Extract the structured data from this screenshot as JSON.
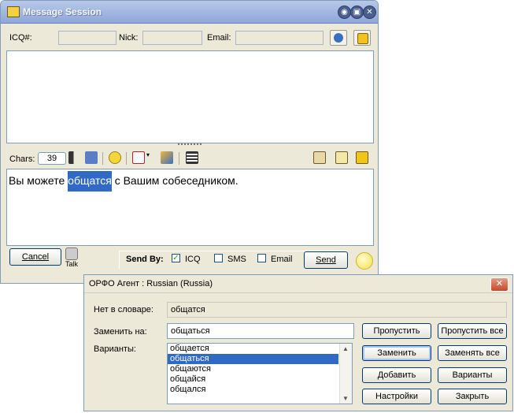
{
  "icq_window": {
    "title": "Message Session",
    "title_buttons": [
      "◉",
      "▣",
      "✕"
    ],
    "info": {
      "icq_label": "ICQ#:",
      "nick_label": "Nick:",
      "email_label": "Email:"
    },
    "toolbar": {
      "chars_label": "Chars:",
      "chars_count": "39"
    },
    "message_parts": {
      "before": "Вы можете ",
      "highlight": "общатся",
      "after": " с Вашим собеседником."
    },
    "bottom": {
      "cancel_label": "Cancel",
      "talk_label": "Talk",
      "send_by_label": "Send By:",
      "icq_option": "ICQ",
      "sms_option": "SMS",
      "email_option": "Email",
      "send_label": "Send",
      "icq_checked": "✓"
    }
  },
  "spell_dialog": {
    "title": "ОРФО Агент : Russian (Russia)",
    "close_glyph": "✕",
    "not_in_dict_label": "Нет в словаре:",
    "not_in_dict_value": "общатся",
    "replace_label": "Заменить на:",
    "replace_value": "общаться",
    "variants_label": "Варианты:",
    "variants": [
      "общается",
      "общаться",
      "общаются",
      "общайся",
      "общался"
    ],
    "selected_variant_index": 1,
    "buttons": {
      "skip": "Пропустить",
      "skip_all": "Пропустить все",
      "replace": "Заменить",
      "replace_all": "Заменять все",
      "add": "Добавить",
      "variants": "Варианты",
      "settings": "Настройки",
      "close": "Закрыть"
    },
    "scroll_up": "▲",
    "scroll_down": "▼"
  },
  "colors": {
    "accent": "#316ac5",
    "window_bg": "#ece9d8",
    "title_blue": "#8ea7d8"
  }
}
